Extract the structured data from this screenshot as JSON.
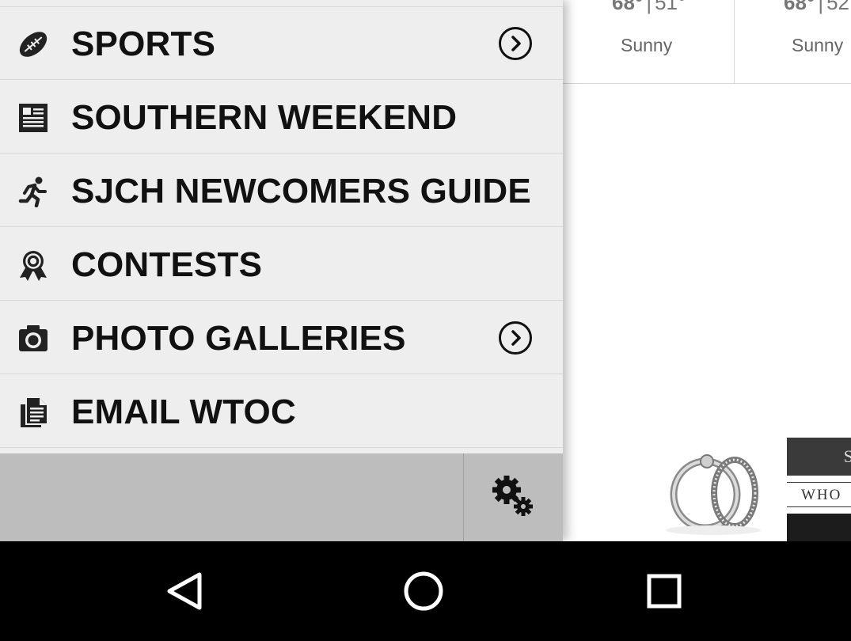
{
  "weather": [
    {
      "hi": "68°",
      "lo": "51°",
      "condition": "Sunny"
    },
    {
      "hi": "68°",
      "lo": "52°",
      "condition": "Sunny"
    }
  ],
  "ad": {
    "top_text": "S",
    "mid_text": "WHO"
  },
  "menu": [
    {
      "label": "SPORTS",
      "icon": "football-icon",
      "has_submenu": true
    },
    {
      "label": "SOUTHERN WEEKEND",
      "icon": "newspaper-icon",
      "has_submenu": false
    },
    {
      "label": "SJCH NEWCOMERS GUIDE",
      "icon": "runner-icon",
      "has_submenu": false
    },
    {
      "label": "CONTESTS",
      "icon": "award-ribbon-icon",
      "has_submenu": false
    },
    {
      "label": "PHOTO GALLERIES",
      "icon": "camera-icon",
      "has_submenu": true
    },
    {
      "label": "EMAIL WTOC",
      "icon": "documents-icon",
      "has_submenu": false
    }
  ],
  "footer": {
    "settings_icon": "gears-icon"
  },
  "navbar": {
    "back_icon": "back-triangle-icon",
    "home_icon": "home-circle-icon",
    "recents_icon": "recents-square-icon"
  }
}
